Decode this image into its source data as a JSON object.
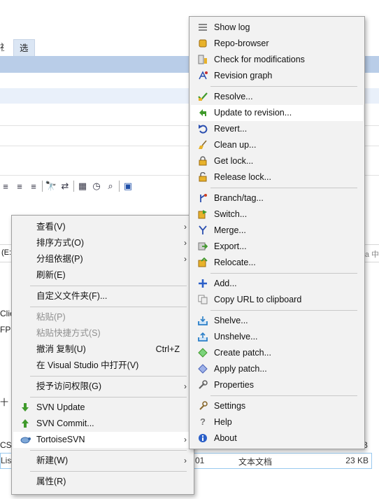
{
  "background": {
    "tabs": [
      "視",
      "选项"
    ],
    "path_left": "(E:",
    "path_right": "a 中",
    "left_fragments": [
      "Clie",
      "FPP",
      "十",
      "CSV",
      "List"
    ],
    "file_row": {
      "date": "01",
      "type": "文本文档",
      "size": "23 KB"
    },
    "row_above_size": "B"
  },
  "context_menu": {
    "items": [
      {
        "label": "查看(V)",
        "arrow": "›"
      },
      {
        "label": "排序方式(O)",
        "arrow": "›"
      },
      {
        "label": "分组依据(P)",
        "arrow": "›"
      },
      {
        "label": "刷新(E)"
      },
      {
        "label": "自定义文件夹(F)..."
      },
      {
        "label": "粘贴(P)",
        "disabled": true
      },
      {
        "label": "粘贴快捷方式(S)",
        "disabled": true
      },
      {
        "label": "撤消 复制(U)",
        "shortcut": "Ctrl+Z"
      },
      {
        "label": "在 Visual Studio 中打开(V)"
      },
      {
        "label": "授予访问权限(G)",
        "arrow": "›"
      },
      {
        "label": "SVN Update",
        "icon": "svn-update-icon"
      },
      {
        "label": "SVN Commit...",
        "icon": "svn-commit-icon"
      },
      {
        "label": "TortoiseSVN",
        "icon": "tortoisesvn-icon",
        "arrow": "›"
      },
      {
        "label": "新建(W)",
        "arrow": "›"
      },
      {
        "label": "属性(R)"
      }
    ]
  },
  "svn_menu": {
    "items": [
      {
        "label": "Show log",
        "icon": "show-log-icon"
      },
      {
        "label": "Repo-browser",
        "icon": "repo-browser-icon"
      },
      {
        "label": "Check for modifications",
        "icon": "check-modifications-icon"
      },
      {
        "label": "Revision graph",
        "icon": "revision-graph-icon"
      },
      {
        "label": "Resolve...",
        "icon": "resolve-icon"
      },
      {
        "label": "Update to revision...",
        "icon": "update-to-revision-icon"
      },
      {
        "label": "Revert...",
        "icon": "revert-icon"
      },
      {
        "label": "Clean up...",
        "icon": "clean-up-icon"
      },
      {
        "label": "Get lock...",
        "icon": "get-lock-icon"
      },
      {
        "label": "Release lock...",
        "icon": "release-lock-icon"
      },
      {
        "label": "Branch/tag...",
        "icon": "branch-tag-icon"
      },
      {
        "label": "Switch...",
        "icon": "switch-icon"
      },
      {
        "label": "Merge...",
        "icon": "merge-icon"
      },
      {
        "label": "Export...",
        "icon": "export-icon"
      },
      {
        "label": "Relocate...",
        "icon": "relocate-icon"
      },
      {
        "label": "Add...",
        "icon": "add-icon"
      },
      {
        "label": "Copy URL to clipboard",
        "icon": "copy-url-icon"
      },
      {
        "label": "Shelve...",
        "icon": "shelve-icon"
      },
      {
        "label": "Unshelve...",
        "icon": "unshelve-icon"
      },
      {
        "label": "Create patch...",
        "icon": "create-patch-icon"
      },
      {
        "label": "Apply patch...",
        "icon": "apply-patch-icon"
      },
      {
        "label": "Properties",
        "icon": "properties-icon"
      },
      {
        "label": "Settings",
        "icon": "settings-icon"
      },
      {
        "label": "Help",
        "icon": "help-icon"
      },
      {
        "label": "About",
        "icon": "about-icon"
      }
    ]
  },
  "colors": {
    "menu_bg": "#f2f2f2",
    "highlight": "#ffffff",
    "selection_band": "#b9cde8",
    "disabled_text": "#8f8f8f"
  }
}
